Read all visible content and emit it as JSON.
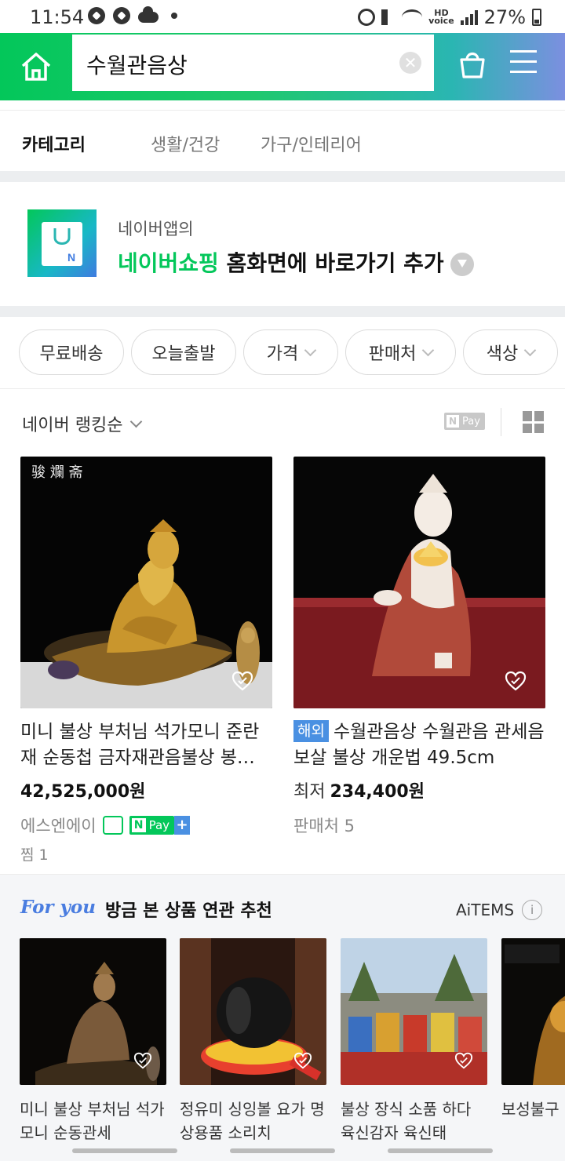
{
  "status": {
    "time": "11:54",
    "battery": "27%",
    "hd_label": "HD",
    "voice_label": "voice"
  },
  "search": {
    "query": "수월관음상"
  },
  "category": {
    "title": "카테고리",
    "items": [
      "생활/건강",
      "가구/인테리어"
    ]
  },
  "banner": {
    "sub": "네이버앱의",
    "highlight": "네이버쇼핑",
    "main_rest": " 홈화면에 바로가기 추가"
  },
  "filters": [
    {
      "label": "무료배송",
      "chevron": false
    },
    {
      "label": "오늘출발",
      "chevron": false
    },
    {
      "label": "가격",
      "chevron": true
    },
    {
      "label": "판매처",
      "chevron": true
    },
    {
      "label": "색상",
      "chevron": true
    }
  ],
  "sort": {
    "label": "네이버 랭킹순",
    "npay_label": "Pay",
    "npay_n": "N"
  },
  "products": [
    {
      "name": "미니 불상 부처님 석가모니 준란재 순동첩 금자재관음불상 봉…",
      "price": "42,525,000원",
      "seller": "에스엔에이",
      "npay_n": "N",
      "npay": "Pay",
      "plus": "+",
      "zzim": "찜 1",
      "logo_text": "骏 斕 斋"
    },
    {
      "tag": "해외",
      "name": "수월관음상 수월관음 관세음 보살 불상 개운법 49.5cm",
      "price_prefix": "최저",
      "price": "234,400원",
      "seller": "판매처 5"
    }
  ],
  "foryou": {
    "logo": "For you",
    "title": "방금 본 상품 연관 추천",
    "aitems": "AiTEMS",
    "info": "i",
    "items": [
      {
        "name": "미니 불상 부처님 석가모니 순동관세"
      },
      {
        "name": "정유미 싱잉볼 요가 명상용품 소리치"
      },
      {
        "name": "불상 장식 소품 하다 육신감자 육신태"
      },
      {
        "name": "보성불구 대만 보화"
      }
    ]
  },
  "colors": {
    "naver_green": "#03c75a",
    "abroad_blue": "#4a90e2"
  }
}
